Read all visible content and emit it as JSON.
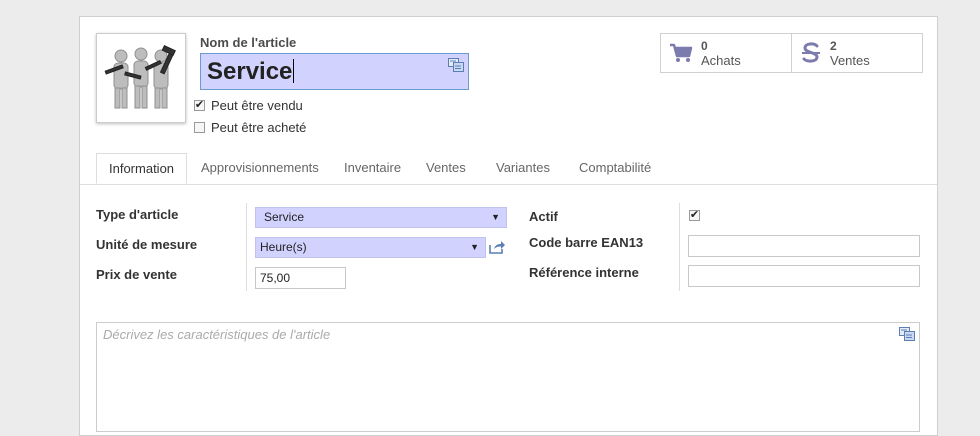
{
  "header": {
    "name_label": "Nom de l'article",
    "name_value": "Service",
    "sale_ok_label": "Peut être vendu",
    "sale_ok_checked": true,
    "purchase_ok_label": "Peut être acheté",
    "purchase_ok_checked": false
  },
  "stats": {
    "purchases": {
      "count": "0",
      "label": "Achats",
      "icon": "cart-icon"
    },
    "sales": {
      "count": "2",
      "label": "Ventes",
      "icon": "dollar-icon"
    }
  },
  "tabs": [
    {
      "label": "Information",
      "active": true
    },
    {
      "label": "Approvisionnements",
      "active": false
    },
    {
      "label": "Inventaire",
      "active": false
    },
    {
      "label": "Ventes",
      "active": false
    },
    {
      "label": "Variantes",
      "active": false
    },
    {
      "label": "Comptabilité",
      "active": false
    }
  ],
  "form": {
    "type_label": "Type d'article",
    "type_value": "Service",
    "uom_label": "Unité de mesure",
    "uom_value": "Heure(s)",
    "price_label": "Prix de vente",
    "price_value": "75,00",
    "active_label": "Actif",
    "active_checked": true,
    "ean_label": "Code barre EAN13",
    "ean_value": "",
    "ref_label": "Référence interne",
    "ref_value": ""
  },
  "description": {
    "placeholder": "Décrivez les caractéristiques de l'article"
  },
  "colors": {
    "required_field": "#d2d2ff",
    "icon_accent": "#7c7bad"
  }
}
